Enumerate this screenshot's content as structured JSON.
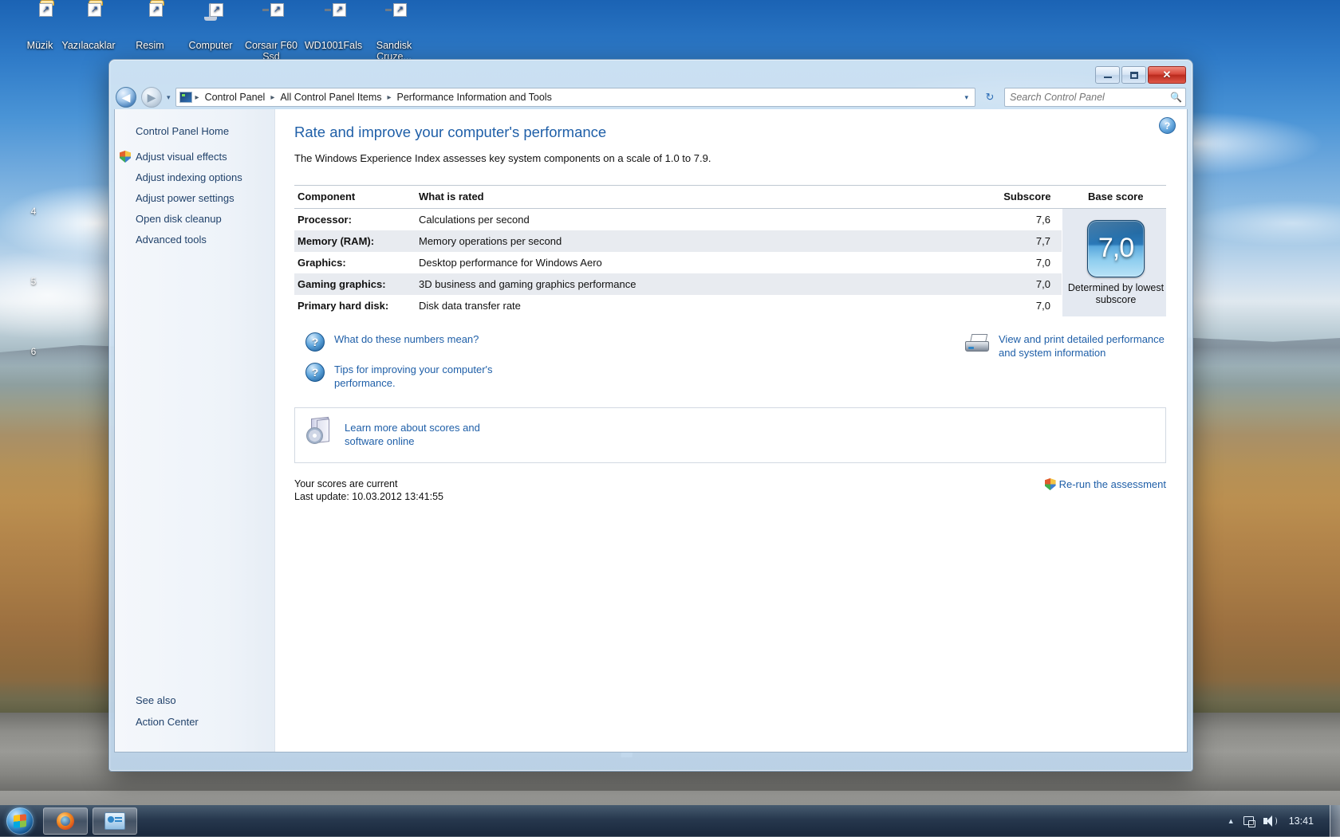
{
  "desktop": {
    "icons": [
      {
        "label": "Müzik",
        "type": "folder-shortcut"
      },
      {
        "label": "Yazılacaklar",
        "type": "folder-shortcut"
      },
      {
        "label": "Resim",
        "type": "folder-shortcut"
      },
      {
        "label": "Computer",
        "type": "computer-shortcut"
      },
      {
        "label": "Corsaır F60 Ssd",
        "type": "drive-shortcut"
      },
      {
        "label": "WD1001Fals",
        "type": "drive-shortcut"
      },
      {
        "label": "Sandisk Cruze...",
        "type": "drive-shortcut"
      }
    ],
    "side_icons": [
      {
        "label": "4"
      },
      {
        "label": "5"
      },
      {
        "label": "6"
      }
    ]
  },
  "window": {
    "controls": {
      "minimize": "minimize-button",
      "maximize": "maximize-button",
      "close_label": "✕"
    },
    "nav": {
      "back": "◀",
      "forward": "▶",
      "recent_caret": "▾",
      "address_caret": "▾",
      "refresh": "↻"
    },
    "breadcrumb": {
      "items": [
        "Control Panel",
        "All Control Panel Items",
        "Performance Information and Tools"
      ],
      "separator": "▸"
    },
    "search": {
      "placeholder": "Search Control Panel",
      "value": "",
      "icon": "search-icon"
    }
  },
  "sidebar": {
    "home": "Control Panel Home",
    "items": [
      {
        "label": "Adjust visual effects",
        "shield": true
      },
      {
        "label": "Adjust indexing options",
        "shield": false
      },
      {
        "label": "Adjust power settings",
        "shield": false
      },
      {
        "label": "Open disk cleanup",
        "shield": false
      },
      {
        "label": "Advanced tools",
        "shield": false
      }
    ],
    "see_also_title": "See also",
    "see_also_items": [
      "Action Center"
    ]
  },
  "main": {
    "help_button": "?",
    "title": "Rate and improve your computer's performance",
    "intro": "The Windows Experience Index assesses key system components on a scale of 1.0 to 7.9.",
    "table": {
      "headers": {
        "component": "Component",
        "what_is_rated": "What is rated",
        "subscore": "Subscore",
        "base_score": "Base score"
      },
      "rows": [
        {
          "component": "Processor:",
          "rated": "Calculations per second",
          "subscore": "7,6"
        },
        {
          "component": "Memory (RAM):",
          "rated": "Memory operations per second",
          "subscore": "7,7"
        },
        {
          "component": "Graphics:",
          "rated": "Desktop performance for Windows Aero",
          "subscore": "7,0"
        },
        {
          "component": "Gaming graphics:",
          "rated": "3D business and gaming graphics performance",
          "subscore": "7,0"
        },
        {
          "component": "Primary hard disk:",
          "rated": "Disk data transfer rate",
          "subscore": "7,0"
        }
      ],
      "base_score": {
        "value": "7,0",
        "caption": "Determined by lowest subscore"
      }
    },
    "links": [
      {
        "label": "What do these numbers mean?",
        "icon": "help-question-icon"
      },
      {
        "label": "Tips for improving your computer's performance.",
        "icon": "help-question-icon"
      }
    ],
    "print_link": {
      "label": "View and print detailed performance and system information",
      "icon": "printer-icon"
    },
    "learn_more": {
      "label": "Learn more about scores and software online",
      "icon": "software-box-icon"
    },
    "status": {
      "line1": "Your scores are current",
      "line2": "Last update: 10.03.2012 13:41:55"
    },
    "rerun": {
      "label": "Re-run the assessment",
      "icon": "shield-icon"
    }
  },
  "taskbar": {
    "start": "start-orb",
    "items": [
      {
        "name": "firefox-taskbar-button"
      },
      {
        "name": "control-panel-taskbar-button"
      }
    ],
    "tray": {
      "arrow": "▲",
      "network": "network-icon",
      "volume": "volume-icon",
      "clock": "13:41"
    }
  },
  "colors": {
    "accent_blue": "#1f5fa8",
    "title_blue": "#1f5fa8",
    "score_box": "#2b79b8",
    "close_red": "#d8483a"
  }
}
